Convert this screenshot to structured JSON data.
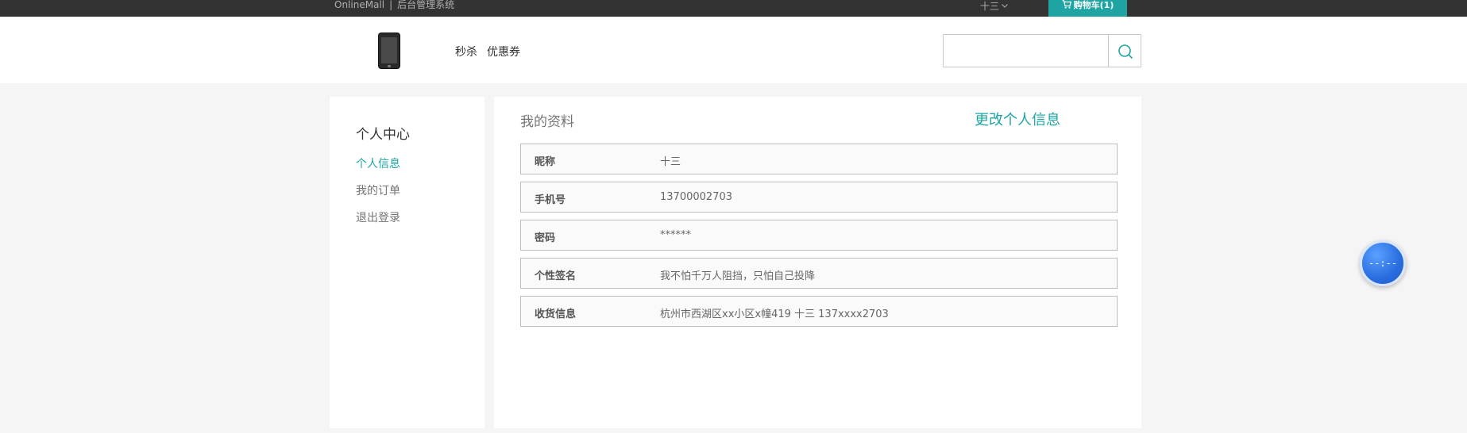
{
  "topbar": {
    "brand": "OnlineMall",
    "separator": "|",
    "subtitle": "后台管理系统",
    "user": "十三",
    "cart_label": "购物车(1)",
    "bg_color": "#333333",
    "cart_color": "#1fa4a4"
  },
  "header": {
    "logo_icon": "phone-icon",
    "nav": [
      "秒杀",
      "优惠券"
    ],
    "search": {
      "value": "",
      "placeholder": ""
    }
  },
  "sidebar": {
    "title": "个人中心",
    "items": [
      {
        "label": "个人信息",
        "active": true
      },
      {
        "label": "我的订单",
        "active": false
      },
      {
        "label": "退出登录",
        "active": false
      }
    ]
  },
  "profile": {
    "title": "我的资料",
    "edit_link": "更改个人信息",
    "rows": [
      {
        "label": "昵称",
        "value": "十三"
      },
      {
        "label": "手机号",
        "value": "13700002703"
      },
      {
        "label": "密码",
        "value": "******"
      },
      {
        "label": "个性签名",
        "value": "我不怕千万人阻挡，只怕自己投降"
      },
      {
        "label": "收货信息",
        "value": "杭州市西湖区xx小区x幢419 十三 137xxxx2703"
      }
    ]
  },
  "float_widget": {
    "text": "--:--"
  },
  "colors": {
    "accent": "#1fa4a4",
    "page_bg": "#f5f5f5"
  }
}
